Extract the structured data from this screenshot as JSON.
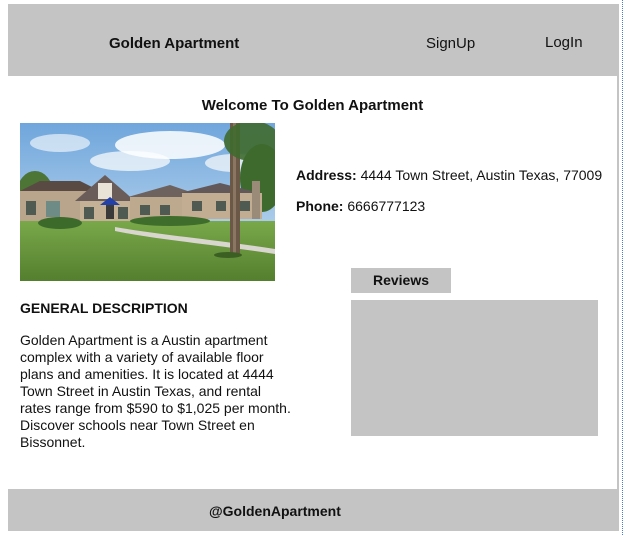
{
  "header": {
    "brand": "Golden Apartment",
    "nav": {
      "signup": "SignUp",
      "login": "LogIn"
    }
  },
  "main": {
    "welcome": "Welcome To Golden Apartment",
    "address_label": "Address:",
    "address_value": "4444 Town Street, Austin Texas, 77009",
    "phone_label": "Phone:",
    "phone_value": "6666777123",
    "reviews_label": "Reviews",
    "description_heading": "GENERAL DESCRIPTION",
    "description_body": "Golden Apartment is a Austin apartment\n complex with a variety of available floor\n plans and amenities. It is located at 4444\n Town Street in Austin Texas, and rental\nrates range from $590 to $1,025 per month.\nDiscover schools near Town Street en\nBissonnet."
  },
  "footer": {
    "handle": "@GoldenApartment"
  },
  "colors": {
    "panel_gray": "#c4c4c4",
    "background": "#ffffff",
    "text": "#111111"
  }
}
